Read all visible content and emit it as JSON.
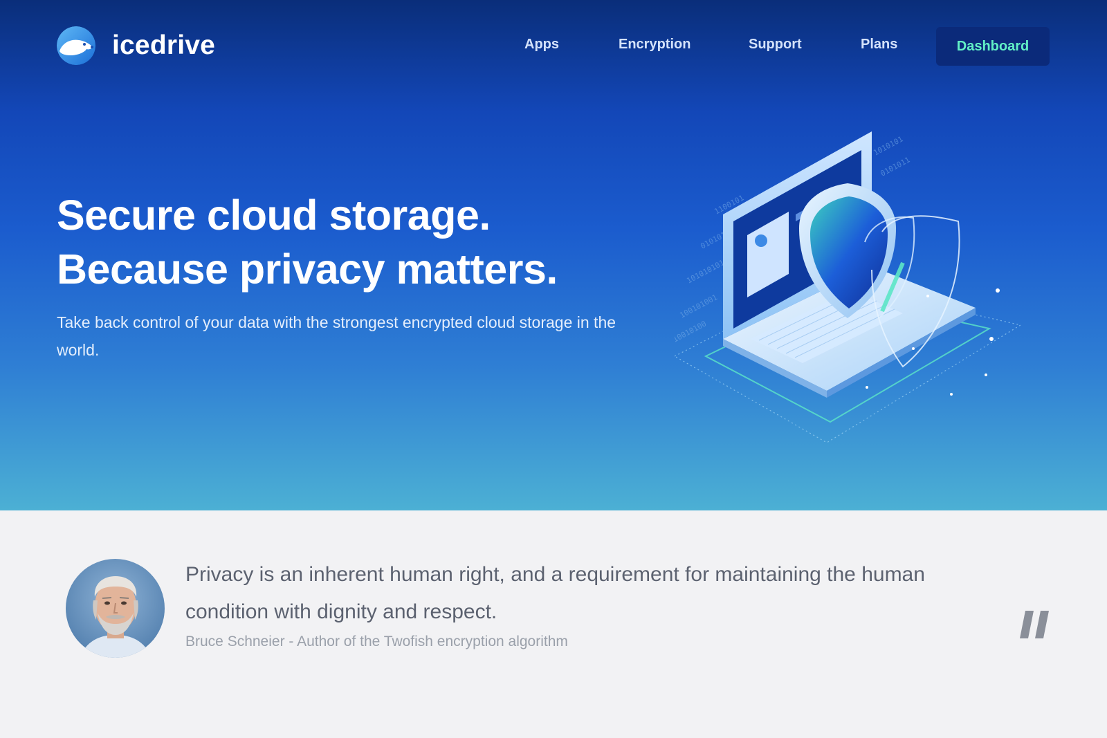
{
  "brand": {
    "name": "icedrive",
    "logo_icon": "polar-bear-logo-icon"
  },
  "nav": {
    "items": [
      {
        "label": "Apps"
      },
      {
        "label": "Encryption"
      },
      {
        "label": "Support"
      },
      {
        "label": "Plans"
      }
    ],
    "cta_label": "Dashboard"
  },
  "hero": {
    "headline_line1": "Secure cloud storage.",
    "headline_line2": "Because privacy matters.",
    "subtext": "Take back control of your data with the strongest encrypted cloud storage in the world.",
    "illustration_icon": "laptop-shield-illustration"
  },
  "quote": {
    "text": "Privacy is an inherent human right, and a requirement for maintaining the human condition with dignity and respect.",
    "author": "Bruce Schneier - Author of the Twofish encryption algorithm",
    "avatar_icon": "author-avatar",
    "mark_icon": "quote-mark-icon"
  },
  "colors": {
    "hero_top": "#0a2e7a",
    "hero_bottom": "#4cb0d4",
    "cta_background": "#0b2a7a",
    "cta_text": "#62f0c6",
    "quote_background": "#f2f2f4",
    "quote_text": "#5c6270"
  }
}
